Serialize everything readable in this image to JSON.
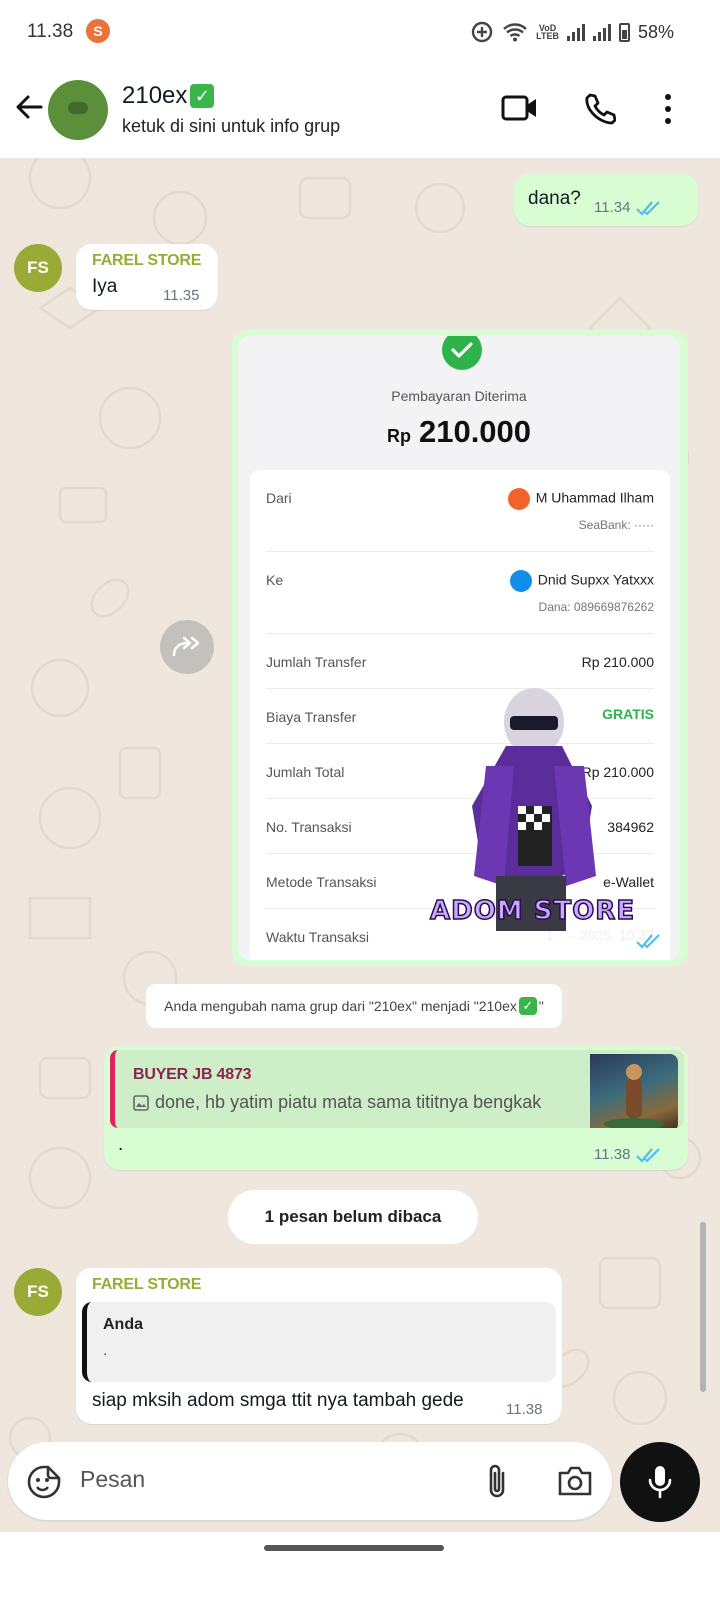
{
  "status_bar": {
    "time": "11.38",
    "app_badge": "S",
    "volte": "VoD\nLTEB",
    "battery": "58%"
  },
  "header": {
    "group_name": "210ex",
    "title_emoji": "✓",
    "subtitle": "ketuk di sini untuk info grup"
  },
  "messages": {
    "m1": {
      "text": "dana?",
      "time": "11.34"
    },
    "m2": {
      "avatar": "FS",
      "sender": "FAREL STORE",
      "text": "Iya",
      "time": "11.35"
    },
    "m3": {
      "time": "11.37",
      "receipt": {
        "title": "Pembayaran Diterima",
        "currency": "Rp",
        "amount": "210.000",
        "from_label": "Dari",
        "from_name": "M Uhammad Ilham",
        "from_bank": "SeaBank: ·····",
        "to_label": "Ke",
        "to_name": "Dnid Supxx Yatxxx",
        "to_detail": "Dana: 089669876262",
        "transfer_label": "Jumlah Transfer",
        "transfer_value": "Rp 210.000",
        "fee_label": "Biaya Transfer",
        "fee_value": "GRATIS",
        "total_label": "Jumlah Total",
        "total_value": "Rp 210.000",
        "trx_label": "No. Transaksi",
        "trx_value": "384962",
        "method_label": "Metode Transaksi",
        "method_value": "e-Wallet",
        "time_label": "Waktu Transaksi",
        "time_value": "1·· ·· 2025, 10:37"
      },
      "sticker_text": "ADOM STORE"
    },
    "system": {
      "text": "Anda mengubah nama grup dari \"210ex\" menjadi \"210ex",
      "text_end": "\""
    },
    "m4": {
      "quote_name": "BUYER JB 4873",
      "quote_text": "done, hb yatim piatu mata sama tititnya bengkak",
      "text": ".",
      "time": "11.38"
    },
    "unread": "1 pesan belum dibaca",
    "m5": {
      "avatar": "FS",
      "sender": "FAREL STORE",
      "quote_name": "Anda",
      "quote_text": ".",
      "text": "siap mksih adom smga ttit nya tambah gede",
      "time": "11.38"
    }
  },
  "input": {
    "placeholder": "Pesan"
  },
  "colors": {
    "outgoing": "#d9fdd3",
    "incoming": "#ffffff",
    "sender": "#9aaa37",
    "tick": "#53bdeb",
    "wallpaper": "#efe7dd"
  }
}
